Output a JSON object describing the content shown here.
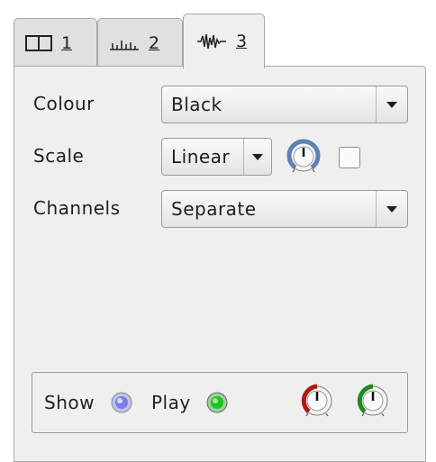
{
  "tabs": [
    {
      "number": "1",
      "icon": "oscilloscope-icon"
    },
    {
      "number": "2",
      "icon": "spectrum-icon"
    },
    {
      "number": "3",
      "icon": "waveform-icon",
      "active": true
    }
  ],
  "fields": {
    "colour": {
      "label": "Colour",
      "value": "Black"
    },
    "scale": {
      "label": "Scale",
      "value": "Linear",
      "checkbox_checked": false
    },
    "channels": {
      "label": "Channels",
      "value": "Separate"
    }
  },
  "footer": {
    "show_label": "Show",
    "play_label": "Play",
    "show_led_color": "#7c7ce8",
    "play_led_color": "#22c022",
    "knob_left_color": "#b01818",
    "knob_right_color": "#1f8a1f"
  },
  "colors": {
    "scale_knob": "#5b82b5"
  }
}
